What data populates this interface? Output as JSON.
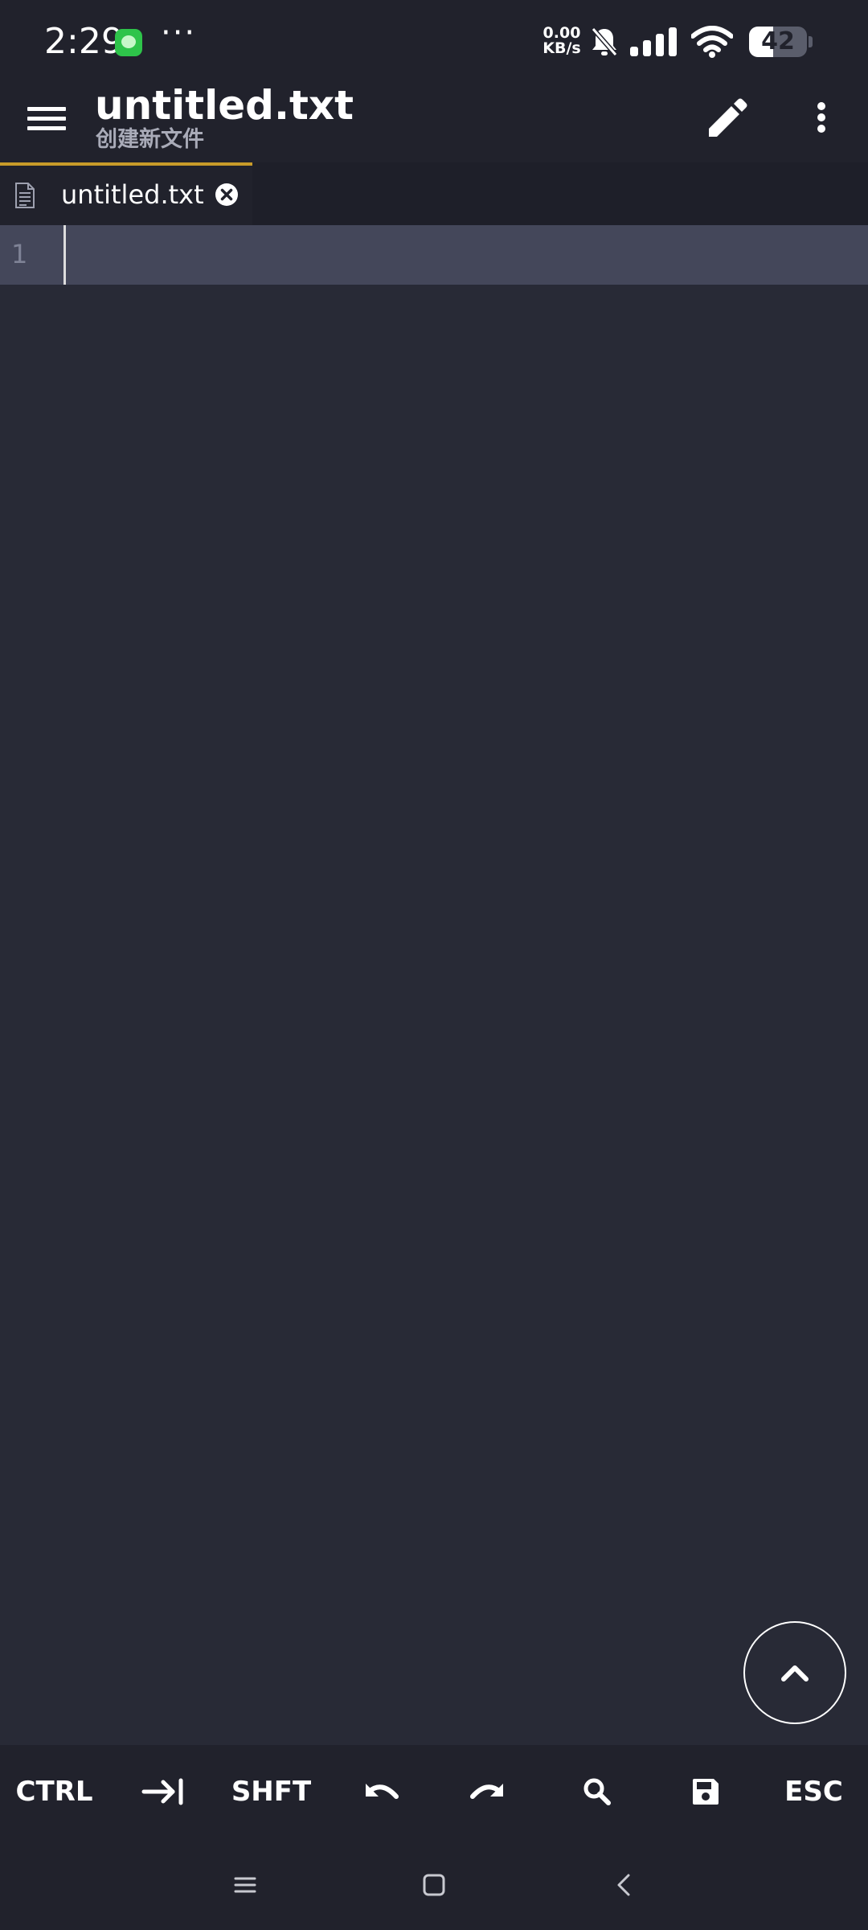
{
  "status_bar": {
    "time": "2:29",
    "more": "···",
    "net_speed_value": "0.00",
    "net_speed_unit": "KB/s",
    "battery_level": "42",
    "battery_fraction": 0.42,
    "icons": [
      "message-app-icon",
      "bell-off-icon",
      "signal-icon",
      "wifi-icon",
      "battery-icon"
    ]
  },
  "app_bar": {
    "title": "untitled.txt",
    "subtitle": "创建新文件",
    "icons": [
      "menu-icon",
      "pencil-icon",
      "more-vert-icon"
    ]
  },
  "tabs": [
    {
      "label": "untitled.txt",
      "icon": "file-text-icon",
      "close_icon": "close-circle-icon",
      "active": true
    }
  ],
  "editor": {
    "line_numbers": [
      "1"
    ],
    "content": ""
  },
  "fab": {
    "icon": "chevron-up-icon"
  },
  "keys": [
    {
      "label": "CTRL",
      "icon": null
    },
    {
      "label": "",
      "icon": "tab-icon"
    },
    {
      "label": "SHFT",
      "icon": null
    },
    {
      "label": "",
      "icon": "undo-icon"
    },
    {
      "label": "",
      "icon": "redo-icon"
    },
    {
      "label": "",
      "icon": "search-icon"
    },
    {
      "label": "",
      "icon": "save-icon"
    },
    {
      "label": "ESC",
      "icon": null
    }
  ],
  "nav_bar": {
    "icons": [
      "recents-icon",
      "home-icon",
      "back-icon"
    ]
  },
  "colors": {
    "background": "#282a36",
    "bars": "#21222c",
    "current_line": "#44475a",
    "tab_indicator": "#c89b29",
    "muted_text": "#a9abb8"
  }
}
